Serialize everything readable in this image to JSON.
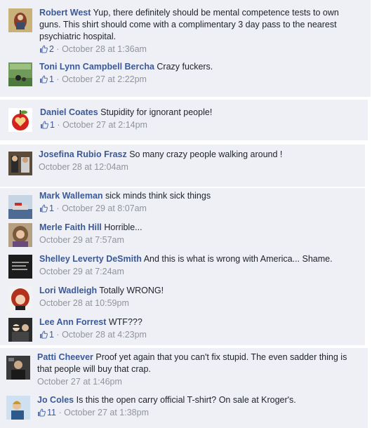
{
  "comments": [
    {
      "name": "Robert West",
      "text": "Yup, there definitely should be mental competence tests to own guns. This shirt should come with a complimentary 3 day pass to the nearest psychiatric hospital.",
      "likes": "2",
      "time": "October 28 at 1:36am"
    },
    {
      "name": "Toni Lynn Campbell Bercha",
      "text": "Crazy fuckers.",
      "likes": "1",
      "time": "October 27 at 2:22pm"
    },
    {
      "name": "Daniel Coates",
      "text": "Stupidity for ignorant people!",
      "likes": "1",
      "time": "October 27 at 2:14pm"
    },
    {
      "name": "Josefina Rubio Frasz",
      "text": "So many crazy people walking around !",
      "likes": "",
      "time": "October 28 at 12:04am"
    },
    {
      "name": "Mark Walleman",
      "text": "sick minds think sick things",
      "likes": "1",
      "time": "October 29 at 8:07am"
    },
    {
      "name": "Merle Faith Hill",
      "text": "Horrible...",
      "likes": "",
      "time": "October 29 at 7:57am"
    },
    {
      "name": "Shelley Leverty DeSmith",
      "text": "And this is what is wrong with America... Shame.",
      "likes": "",
      "time": "October 29 at 7:24am"
    },
    {
      "name": "Lori Wadleigh",
      "text": "Totally WRONG!",
      "likes": "",
      "time": "October 28 at 10:59pm"
    },
    {
      "name": "Lee Ann Forrest",
      "text": "WTF???",
      "likes": "1",
      "time": "October 28 at 4:23pm"
    },
    {
      "name": "Patti Cheever",
      "text": "Proof yet again that you can't fix stupid. The even sadder thing is that people will buy that crap.",
      "likes": "",
      "time": "October 27 at 1:46pm"
    },
    {
      "name": "Jo Coles",
      "text": "Is this the open carry official T-shirt? On sale at Kroger's.",
      "likes": "11",
      "time": "October 27 at 1:38pm"
    }
  ],
  "colors": {
    "name_link": "#3b5998",
    "meta_gray": "#90949c",
    "comment_bg": "#eef0f5"
  },
  "icons": {
    "like": "thumbs-up-icon"
  }
}
